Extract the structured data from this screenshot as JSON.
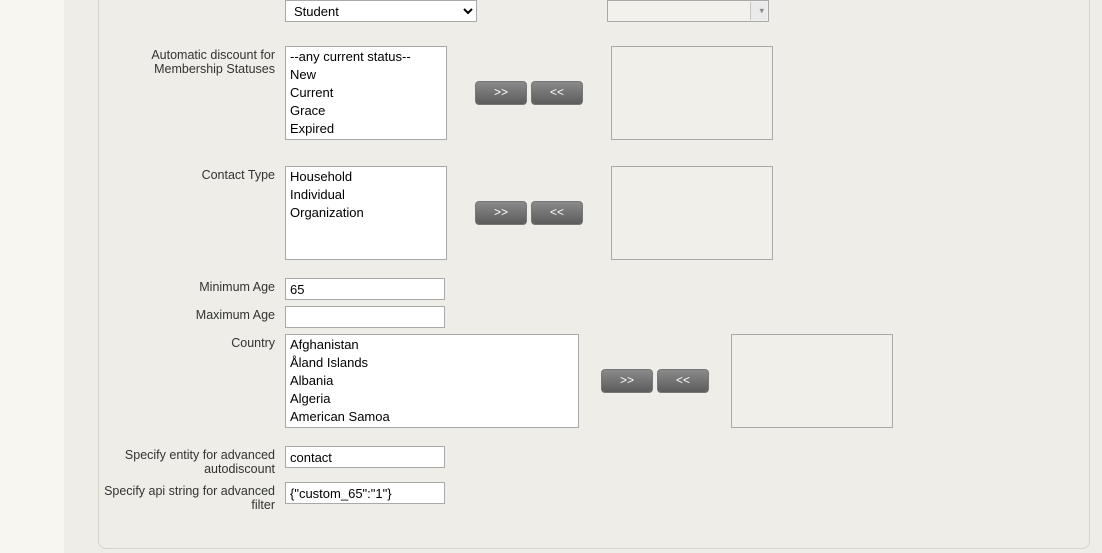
{
  "top": {
    "dropdown_value": "Student"
  },
  "labels": {
    "membership_statuses": "Automatic discount for Membership Statuses",
    "contact_type": "Contact Type",
    "minimum_age": "Minimum Age",
    "maximum_age": "Maximum Age",
    "country": "Country",
    "entity": "Specify entity for advanced autodiscount",
    "api_string": "Specify api string for advanced filter"
  },
  "buttons": {
    "move_right": ">>",
    "move_left": "<<"
  },
  "lists": {
    "membership_statuses": [
      "--any current status--",
      "New",
      "Current",
      "Grace",
      "Expired"
    ],
    "contact_types": [
      "Household",
      "Individual",
      "Organization"
    ],
    "countries": [
      "Afghanistan",
      "Åland Islands",
      "Albania",
      "Algeria",
      "American Samoa"
    ]
  },
  "fields": {
    "minimum_age": "65",
    "maximum_age": "",
    "entity": "contact",
    "api_string": "{\"custom_65\":\"1\"}"
  }
}
